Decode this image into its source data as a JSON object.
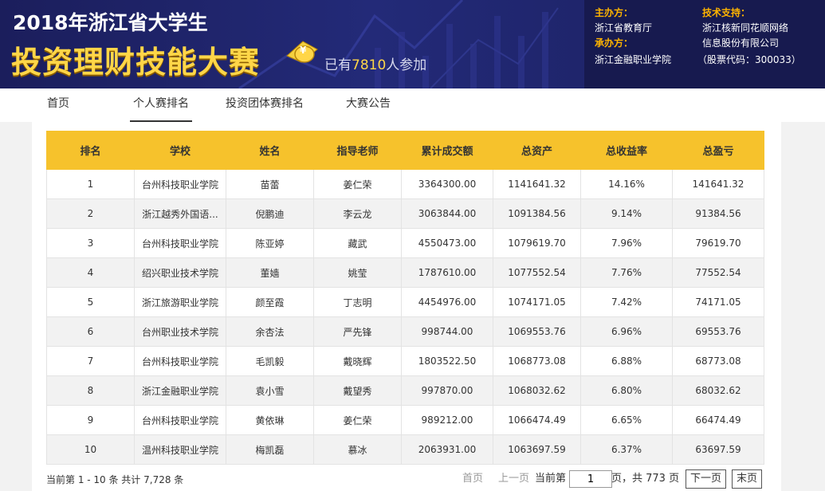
{
  "banner": {
    "title_line1": "2018年浙江省大学生",
    "title_line2": "投资理财技能大赛",
    "participants_prefix": "已有",
    "participants_count": "7810",
    "participants_suffix": "人参加",
    "host_label": "主办方：",
    "host_value": "浙江省教育厅",
    "organizer_label": "承办方：",
    "organizer_value": "浙江金融职业学院",
    "tech_label": "技术支持：",
    "tech_value1": "浙江核新同花顺网络",
    "tech_value2": "信息股份有限公司",
    "stock_code": "（股票代码：300033）"
  },
  "nav": {
    "items": [
      "首页",
      "个人赛排名",
      "投资团体赛排名",
      "大赛公告"
    ],
    "active_index": 1
  },
  "table": {
    "headers": [
      "排名",
      "学校",
      "姓名",
      "指导老师",
      "累计成交额",
      "总资产",
      "总收益率",
      "总盈亏"
    ],
    "rows": [
      [
        "1",
        "台州科技职业学院",
        "苗蕾",
        "姜仁荣",
        "3364300.00",
        "1141641.32",
        "14.16%",
        "141641.32"
      ],
      [
        "2",
        "浙江越秀外国语...",
        "倪鹏迪",
        "李云龙",
        "3063844.00",
        "1091384.56",
        "9.14%",
        "91384.56"
      ],
      [
        "3",
        "台州科技职业学院",
        "陈亚婷",
        "藏武",
        "4550473.00",
        "1079619.70",
        "7.96%",
        "79619.70"
      ],
      [
        "4",
        "绍兴职业技术学院",
        "董嫱",
        "姚莹",
        "1787610.00",
        "1077552.54",
        "7.76%",
        "77552.54"
      ],
      [
        "5",
        "浙江旅游职业学院",
        "颜至霞",
        "丁志明",
        "4454976.00",
        "1074171.05",
        "7.42%",
        "74171.05"
      ],
      [
        "6",
        "台州职业技术学院",
        "余杏法",
        "严先锋",
        "998744.00",
        "1069553.76",
        "6.96%",
        "69553.76"
      ],
      [
        "7",
        "台州科技职业学院",
        "毛凯毅",
        "戴晓辉",
        "1803522.50",
        "1068773.08",
        "6.88%",
        "68773.08"
      ],
      [
        "8",
        "浙江金融职业学院",
        "袁小雪",
        "戴望秀",
        "997870.00",
        "1068032.62",
        "6.80%",
        "68032.62"
      ],
      [
        "9",
        "台州科技职业学院",
        "黄依琳",
        "姜仁荣",
        "989212.00",
        "1066474.49",
        "6.65%",
        "66474.49"
      ],
      [
        "10",
        "温州科技职业学院",
        "梅凯磊",
        "慕冰",
        "2063931.00",
        "1063697.59",
        "6.37%",
        "63697.59"
      ]
    ]
  },
  "footer": {
    "summary": "当前第 1 - 10 条 共计 7,728 条",
    "first": "首页",
    "prev": "上一页",
    "current_prefix": "当前第",
    "current_page": "1",
    "total_text": "页，共 773 页",
    "next": "下一页",
    "last": "末页"
  },
  "colors": {
    "banner_bg": "#1f2470",
    "title_yellow": "#ffd648",
    "label_orange": "#ffb400",
    "table_header": "#f6c22c"
  }
}
